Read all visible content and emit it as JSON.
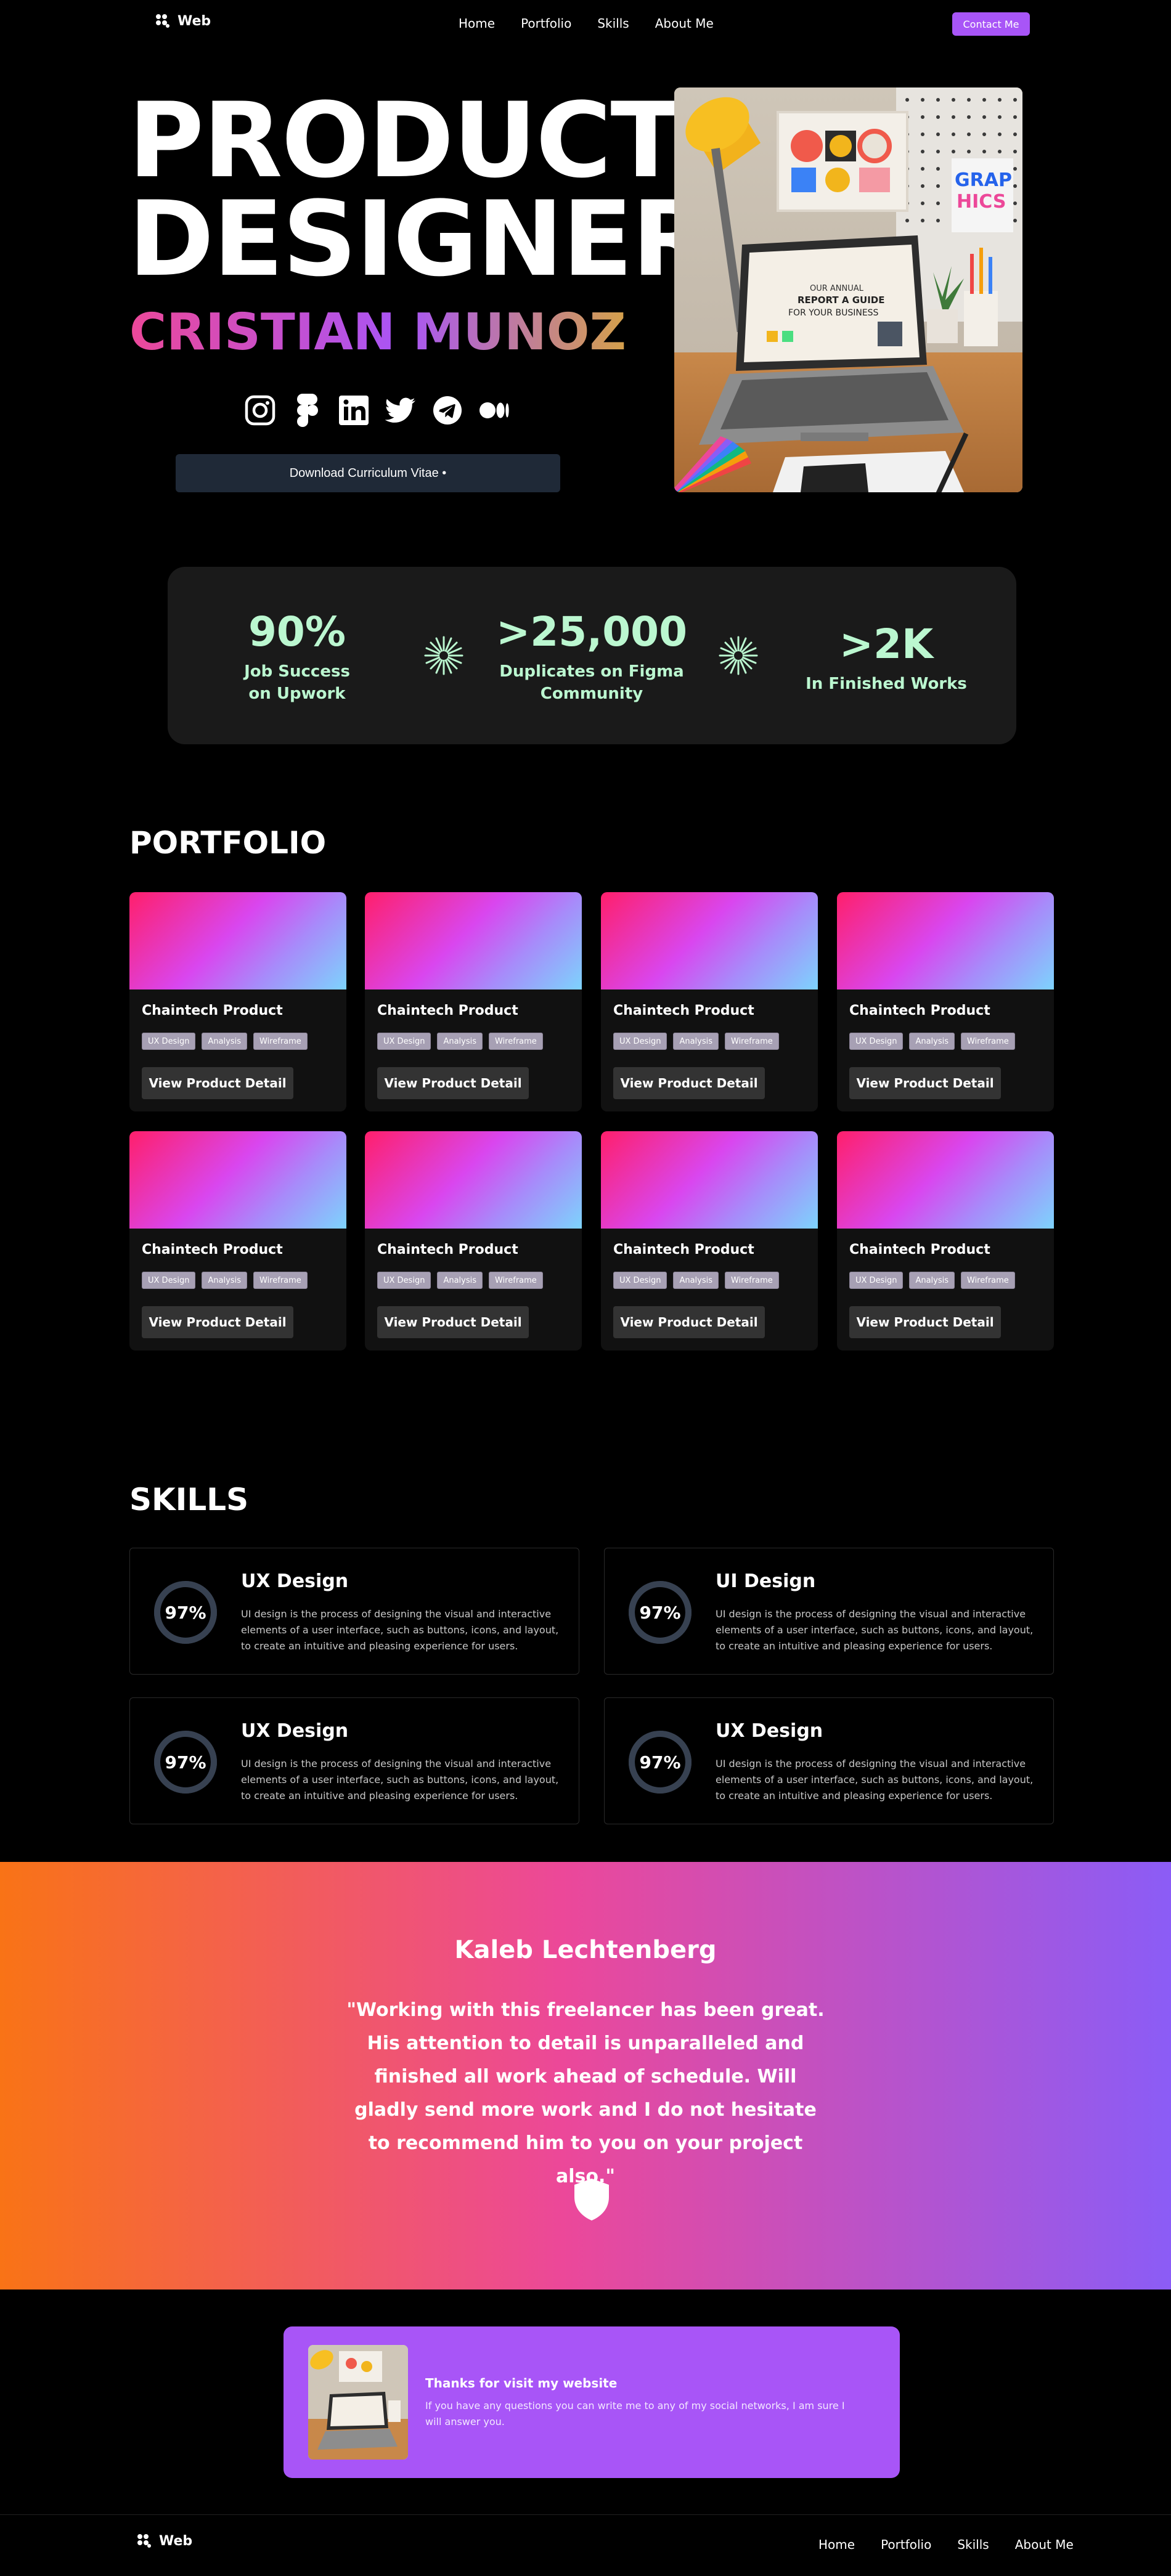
{
  "nav": {
    "logo_text": "Web",
    "links": [
      "Home",
      "Portfolio",
      "Skills",
      "About Me"
    ],
    "contact_label": "Contact Me"
  },
  "hero": {
    "title_line1": "PRODUCT",
    "title_line2": "DESIGNER",
    "name": "CRISTIAN MUNOZ",
    "socials": [
      "instagram-icon",
      "figma-icon",
      "linkedin-icon",
      "twitter-icon",
      "telegram-icon",
      "medium-icon"
    ],
    "cv_button": "Download Curriculum Vitae •",
    "laptop_screen_text": [
      "OUR ANNUAL",
      "REPORT A GUIDE",
      "FOR YOUR BUSINESS"
    ],
    "poster_text": [
      "GRAP",
      "HICS"
    ]
  },
  "stats": [
    {
      "value": "90%",
      "label_line1": "Job Success",
      "label_line2": "on Upwork"
    },
    {
      "value": ">25,000",
      "label_line1": "Duplicates on Figma",
      "label_line2": "Community"
    },
    {
      "value": ">2K",
      "label_line1": "In Finished Works",
      "label_line2": ""
    }
  ],
  "portfolio": {
    "title": "PORTFOLIO",
    "cards": [
      {
        "title": "Chaintech Product",
        "tags": [
          "UX Design",
          "Analysis",
          "Wireframe"
        ],
        "button": "View Product Detail"
      },
      {
        "title": "Chaintech Product",
        "tags": [
          "UX Design",
          "Analysis",
          "Wireframe"
        ],
        "button": "View Product Detail"
      },
      {
        "title": "Chaintech Product",
        "tags": [
          "UX Design",
          "Analysis",
          "Wireframe"
        ],
        "button": "View Product Detail"
      },
      {
        "title": "Chaintech Product",
        "tags": [
          "UX Design",
          "Analysis",
          "Wireframe"
        ],
        "button": "View Product Detail"
      },
      {
        "title": "Chaintech Product",
        "tags": [
          "UX Design",
          "Analysis",
          "Wireframe"
        ],
        "button": "View Product Detail"
      },
      {
        "title": "Chaintech Product",
        "tags": [
          "UX Design",
          "Analysis",
          "Wireframe"
        ],
        "button": "View Product Detail"
      },
      {
        "title": "Chaintech Product",
        "tags": [
          "UX Design",
          "Analysis",
          "Wireframe"
        ],
        "button": "View Product Detail"
      },
      {
        "title": "Chaintech Product",
        "tags": [
          "UX Design",
          "Analysis",
          "Wireframe"
        ],
        "button": "View Product Detail"
      }
    ]
  },
  "skills": {
    "title": "SKILLS",
    "items": [
      {
        "percent": "97%",
        "level": 0.97,
        "name": "UX Design",
        "desc": "UI design is the process of designing the visual and interactive elements of a user interface, such as buttons, icons, and layout, to create an intuitive and pleasing experience for users."
      },
      {
        "percent": "97%",
        "level": 0.97,
        "name": "UI Design",
        "desc": "UI design is the process of designing the visual and interactive elements of a user interface, such as buttons, icons, and layout, to create an intuitive and pleasing experience for users."
      },
      {
        "percent": "97%",
        "level": 0.97,
        "name": "UX Design",
        "desc": "UI design is the process of designing the visual and interactive elements of a user interface, such as buttons, icons, and layout, to create an intuitive and pleasing experience for users."
      },
      {
        "percent": "97%",
        "level": 0.97,
        "name": "UX Design",
        "desc": "UI design is the process of designing the visual and interactive elements of a user interface, such as buttons, icons, and layout, to create an intuitive and pleasing experience for users."
      }
    ]
  },
  "testimonial": {
    "name": "Kaleb Lechtenberg",
    "quote": "\"Working with this freelancer has been great. His attention to detail is unparalleled and finished all work ahead of schedule. Will gladly send more work and I do not hesitate to recommend him to you on your project also.\""
  },
  "cta": {
    "heading": "Thanks for visit my website",
    "text": "If you have any questions you can write me to any of my social networks, I am sure I will answer you."
  },
  "footer": {
    "logo_text": "Web",
    "links": [
      "Home",
      "Portfolio",
      "Skills",
      "About Me"
    ]
  },
  "colors": {
    "accent": "#a855f7",
    "stat_green": "#bbf7d0",
    "ring_track": "#374151"
  }
}
